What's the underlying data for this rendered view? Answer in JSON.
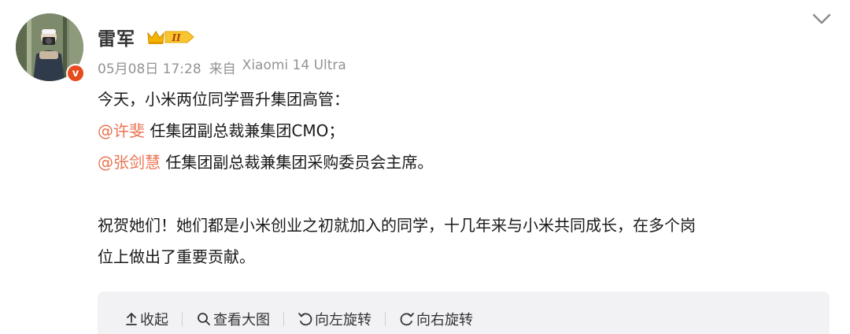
{
  "user": {
    "name": "雷军",
    "vip_level": "II"
  },
  "meta": {
    "time": "05月08日 17:28",
    "source_prefix": "来自",
    "source_device": "Xiaomi 14 Ultra"
  },
  "post": {
    "line1": "今天，小米两位同学晋升集团高管：",
    "mention1": "@许斐",
    "line2_rest": " 任集团副总裁兼集团CMO；",
    "mention2": "@张剑慧",
    "line3_rest": " 任集团副总裁兼集团采购委员会主席。",
    "line4": "祝贺她们！她们都是小米创业之初就加入的同学，十几年来与小米共同成长，在多个岗",
    "line5": "位上做出了重要贡献。"
  },
  "toolbar": {
    "collapse_label": "收起",
    "view_large_label": "查看大图",
    "rotate_left_label": "向左旋转",
    "rotate_right_label": "向右旋转"
  },
  "colors": {
    "mention": "#eb7350",
    "meta": "#939393",
    "verified": "#e64a1d",
    "toolbar_bg": "#f2f2f5"
  },
  "icons": [
    "chevron-down-icon",
    "crown-vip-icon",
    "verified-v-icon",
    "collapse-up-icon",
    "magnifier-icon",
    "rotate-left-icon",
    "rotate-right-icon"
  ]
}
